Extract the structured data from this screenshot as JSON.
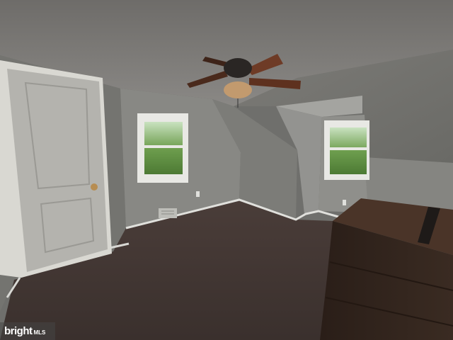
{
  "watermark": {
    "brand": "bright",
    "suffix": "MLS"
  },
  "colors": {
    "ceiling": "#7a7875",
    "wall_left": "#777773",
    "wall_back": "#8a8a86",
    "carpet": "#3d3330",
    "door": "#9b9a95",
    "dresser": "#2e221c",
    "fan_blade": "#6e3b26",
    "window_glass": "#7aa85a"
  },
  "scene": {
    "description_objects": [
      "ceiling-fan",
      "door",
      "window-left",
      "window-dormer",
      "dresser",
      "carpet",
      "floor-vent",
      "baseboard"
    ]
  }
}
